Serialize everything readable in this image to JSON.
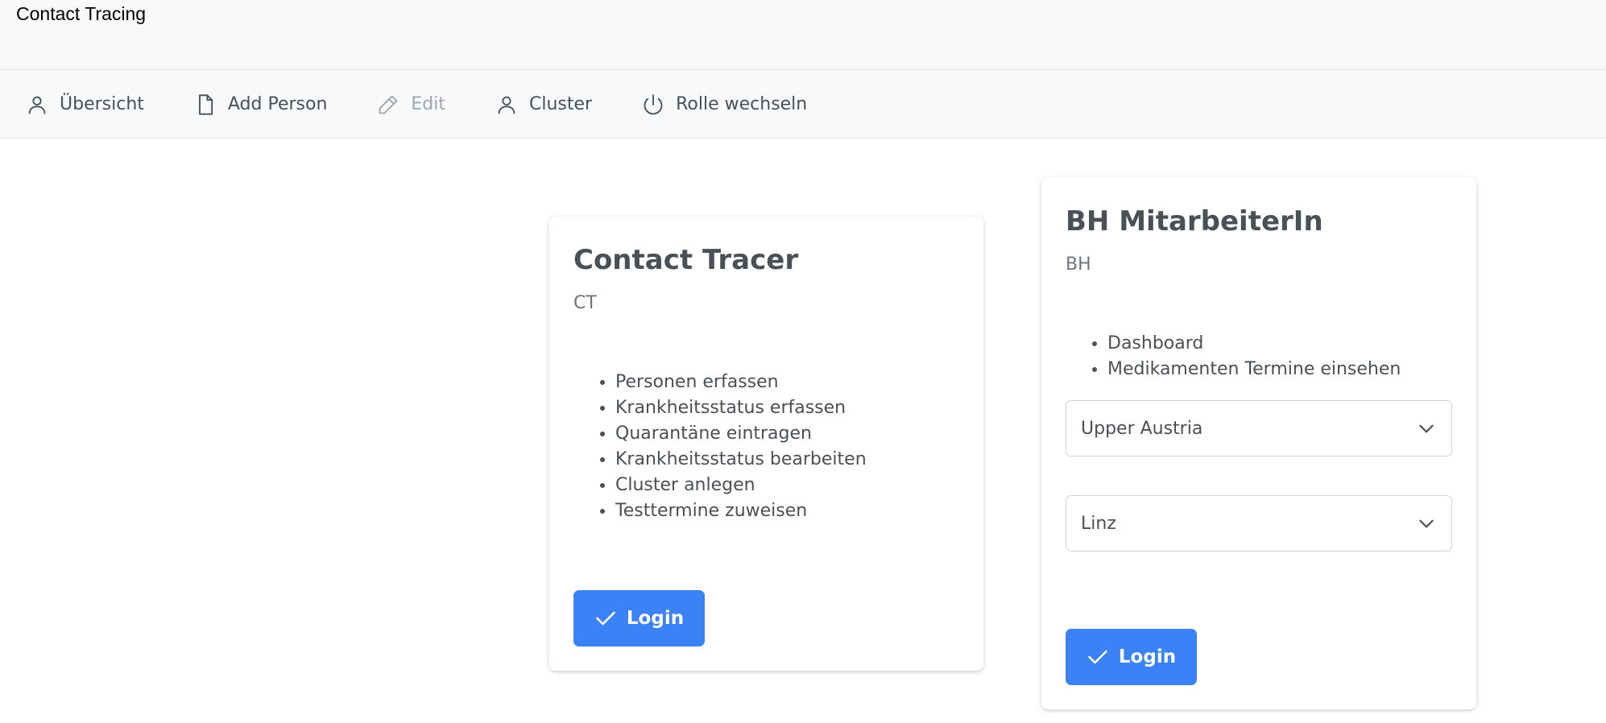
{
  "app": {
    "title": "Contact Tracing"
  },
  "menu": {
    "items": [
      {
        "label": "Übersicht",
        "icon": "user-icon",
        "disabled": false
      },
      {
        "label": "Add Person",
        "icon": "file-icon",
        "disabled": false
      },
      {
        "label": "Edit",
        "icon": "pencil-icon",
        "disabled": true
      },
      {
        "label": "Cluster",
        "icon": "user-icon",
        "disabled": false
      },
      {
        "label": "Rolle wechseln",
        "icon": "power-icon",
        "disabled": false
      }
    ]
  },
  "roles": [
    {
      "title": "Contact Tracer",
      "code": "CT",
      "features": [
        "Personen erfassen",
        "Krankheitsstatus erfassen",
        "Quarantäne eintragen",
        "Krankheitsstatus bearbeiten",
        "Cluster anlegen",
        "Testtermine zuweisen"
      ],
      "login_label": "Login"
    },
    {
      "title": "BH MitarbeiterIn",
      "code": "BH",
      "features": [
        "Dashboard",
        "Medikamenten Termine einsehen"
      ],
      "state_select": "Upper Austria",
      "district_select": "Linz",
      "login_label": "Login"
    }
  ],
  "colors": {
    "accent": "#3b82f6",
    "menubar_bg": "#f8f9fb"
  }
}
